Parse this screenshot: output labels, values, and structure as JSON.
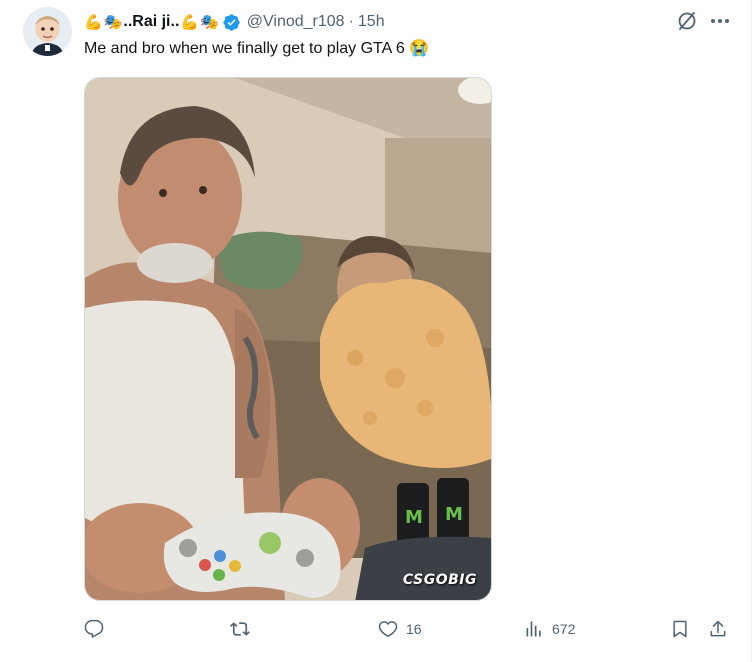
{
  "tweet": {
    "display_name": "..Rai ji..",
    "name_emojis_before": [
      "💪",
      "🎭"
    ],
    "name_emojis_after": [
      "💪",
      "🎭"
    ],
    "handle": "@Vinod_r108",
    "separator": "·",
    "time": "15h",
    "text": "Me and bro when we finally get to play GTA 6",
    "text_emoji": "😭",
    "media_watermark": "CSGOBIG",
    "icons": {
      "verified": "verified-badge-icon",
      "grok": "grok-icon",
      "more": "more-icon",
      "reply": "reply-icon",
      "retweet": "retweet-icon",
      "like": "like-icon",
      "views": "views-icon",
      "bookmark": "bookmark-icon",
      "share": "share-icon"
    },
    "actions": {
      "reply_count": "",
      "retweet_count": "",
      "like_count": "16",
      "views_count": "672"
    },
    "colors": {
      "verified": "#1d9bf0",
      "secondary_text": "#536471",
      "primary_text": "#0f1419"
    }
  }
}
